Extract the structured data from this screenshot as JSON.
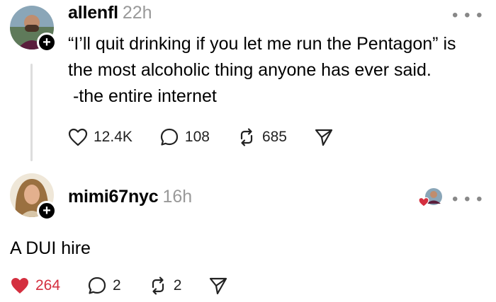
{
  "post1": {
    "username": "allenfl",
    "time": "22h",
    "lines": [
      "“I’ll quit drinking if you let me run the Pentagon” is",
      "the most alcoholic thing anyone has ever said.",
      " -the entire internet"
    ],
    "likes": "12.4K",
    "replies": "108",
    "reposts": "685"
  },
  "post2": {
    "username": "mimi67nyc",
    "time": "16h",
    "text": "A DUI hire",
    "likes": "264",
    "replies": "2",
    "reposts": "2",
    "liked_color": "#d42f3f"
  },
  "icons": {
    "more": "more-icon",
    "like": "heart-icon",
    "reply": "comment-icon",
    "repost": "repost-icon",
    "share": "send-icon",
    "follow": "plus-icon"
  },
  "more_glyph": "• • •",
  "follow_glyph": "+"
}
